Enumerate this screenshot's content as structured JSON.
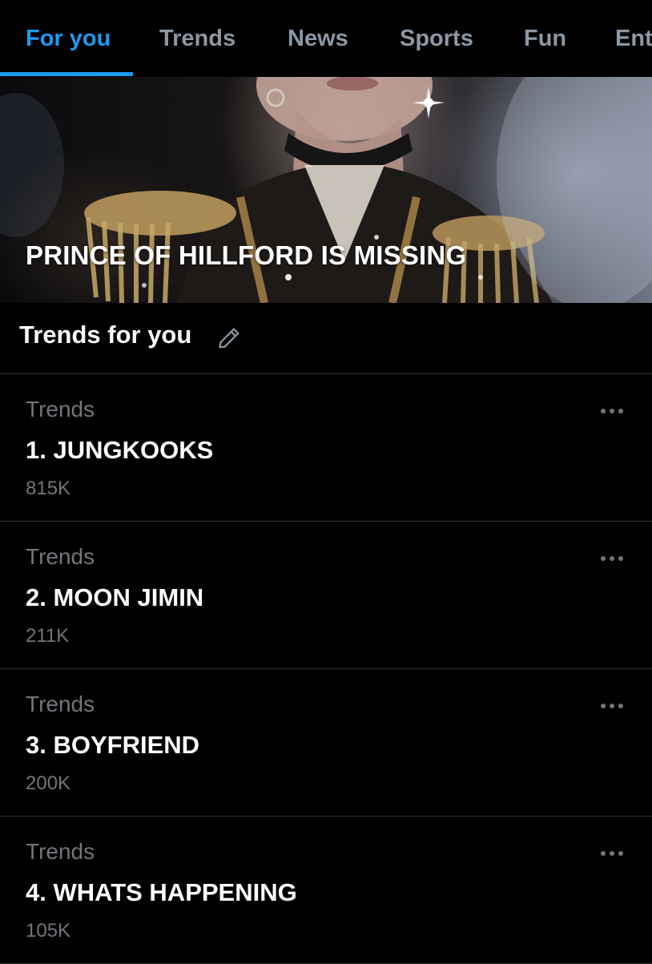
{
  "tabs": [
    {
      "label": "For you",
      "active": true
    },
    {
      "label": "Trends",
      "active": false
    },
    {
      "label": "News",
      "active": false
    },
    {
      "label": "Sports",
      "active": false
    },
    {
      "label": "Fun",
      "active": false
    },
    {
      "label": "Ent",
      "active": false
    }
  ],
  "hero": {
    "title": "PRINCE OF HILLFORD IS MISSING"
  },
  "section": {
    "title": "Trends for you",
    "edit_icon": "pencil-icon"
  },
  "trends": [
    {
      "context": "Trends",
      "name": "1. JUNGKOOKS",
      "count": "815K"
    },
    {
      "context": "Trends",
      "name": "2. MOON JIMIN",
      "count": "211K"
    },
    {
      "context": "Trends",
      "name": "3. BOYFRIEND",
      "count": "200K"
    },
    {
      "context": "Trends",
      "name": "4. WHATS HAPPENING",
      "count": "105K"
    }
  ],
  "icons": {
    "more": "more-horizontal-icon",
    "edit": "pencil-icon"
  },
  "colors": {
    "accent": "#1d9bf0",
    "background": "#000000",
    "muted_text": "#71767b",
    "tab_inactive": "#8b98a5",
    "divider": "#2f3336"
  }
}
